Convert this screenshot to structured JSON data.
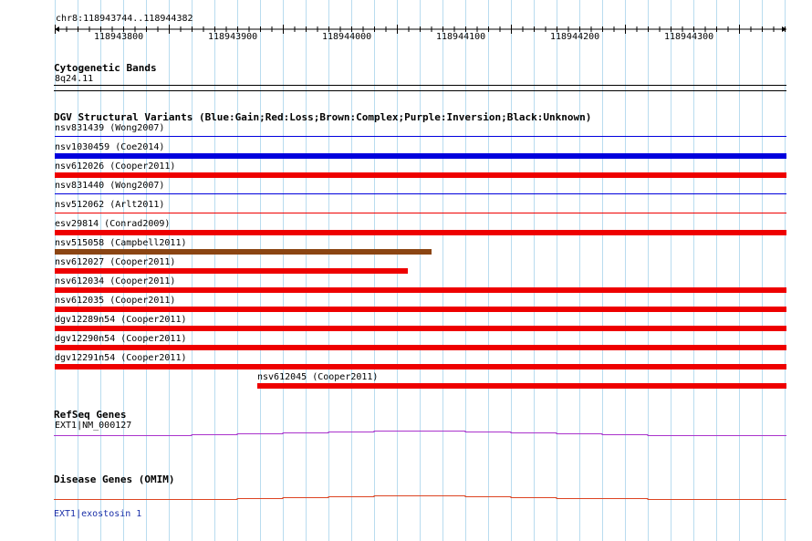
{
  "ruler": {
    "location": "chr8:118943744..118944382",
    "ticks": [
      "118943800",
      "118943900",
      "118944000",
      "118944100",
      "118944200",
      "118944300"
    ]
  },
  "cytoband": {
    "title": "Cytogenetic Bands",
    "band": "8q24.11"
  },
  "dgv": {
    "title": "DGV Structural Variants (Blue:Gain;Red:Loss;Brown:Complex;Purple:Inversion;Black:Unknown)",
    "colors": {
      "gain": "#0000dd",
      "loss": "#ee0000",
      "complex": "#8b4513"
    },
    "variants": [
      {
        "label": "nsv831439 (Wong2007)",
        "type": "gain",
        "bar": "thin"
      },
      {
        "label": "nsv1030459 (Coe2014)",
        "type": "gain",
        "bar": "thick"
      },
      {
        "label": "nsv612026 (Cooper2011)",
        "type": "loss",
        "bar": "thick"
      },
      {
        "label": "nsv831440 (Wong2007)",
        "type": "gain",
        "bar": "thin"
      },
      {
        "label": "nsv512062 (Arlt2011)",
        "type": "loss",
        "bar": "thin"
      },
      {
        "label": "esv29814 (Conrad2009)",
        "type": "loss",
        "bar": "thick"
      },
      {
        "label": "nsv515058 (Campbell2011)",
        "type": "complex",
        "bar": "thick"
      },
      {
        "label": "nsv612027 (Cooper2011)",
        "type": "loss",
        "bar": "thick"
      },
      {
        "label": "nsv612034 (Cooper2011)",
        "type": "loss",
        "bar": "thick"
      },
      {
        "label": "nsv612035 (Cooper2011)",
        "type": "loss",
        "bar": "thick"
      },
      {
        "label": "dgv12289n54 (Cooper2011)",
        "type": "loss",
        "bar": "thick"
      },
      {
        "label": "dgv12290n54 (Cooper2011)",
        "type": "loss",
        "bar": "thick"
      },
      {
        "label": "dgv12291n54 (Cooper2011)",
        "type": "loss",
        "bar": "thick"
      },
      {
        "label": "nsv612045 (Cooper2011)",
        "type": "loss",
        "bar": "thick"
      }
    ]
  },
  "refseq": {
    "title": "RefSeq Genes",
    "gene": "EXT1|NM_000127",
    "color": "#aa33cc"
  },
  "omim": {
    "title": "Disease Genes (OMIM)",
    "gene": "EXT1|exostosin 1",
    "color": "#dd4422"
  }
}
